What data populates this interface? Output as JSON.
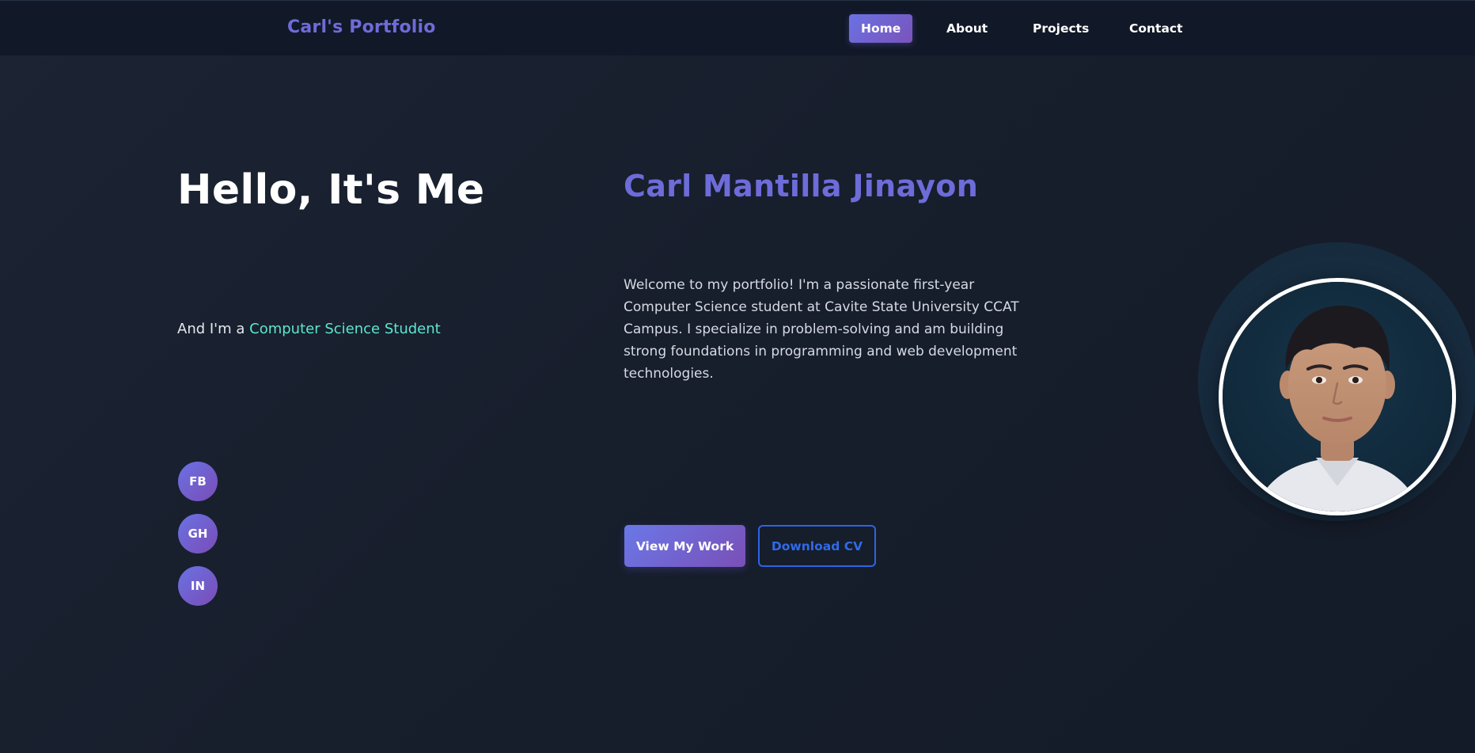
{
  "brand": "Carl's Portfolio",
  "nav": {
    "items": [
      {
        "label": "Home",
        "active": true
      },
      {
        "label": "About",
        "active": false
      },
      {
        "label": "Projects",
        "active": false
      },
      {
        "label": "Contact",
        "active": false
      }
    ]
  },
  "hero": {
    "greeting": "Hello, It's Me",
    "role_prefix": "And I'm a ",
    "role": "Computer Science Student",
    "name": "Carl Mantilla Jinayon",
    "bio": "Welcome to my portfolio! I'm a passionate first-year Computer Science student at Cavite State University CCAT Campus. I specialize in problem-solving and am building strong foundations in programming and web development technologies.",
    "primary_button": "View My Work",
    "secondary_button": "Download CV"
  },
  "social": [
    {
      "label": "FB",
      "icon": "facebook-icon"
    },
    {
      "label": "GH",
      "icon": "github-icon"
    },
    {
      "label": "IN",
      "icon": "linkedin-icon"
    }
  ],
  "colors": {
    "accent_gradient_start": "#6a72e4",
    "accent_gradient_end": "#7a53ba",
    "brand": "#6f6bd8",
    "role_highlight": "#5de6cf",
    "outline_button": "#2d64e6",
    "navbar_bg": "#111827",
    "page_bg": "#171e2c"
  }
}
